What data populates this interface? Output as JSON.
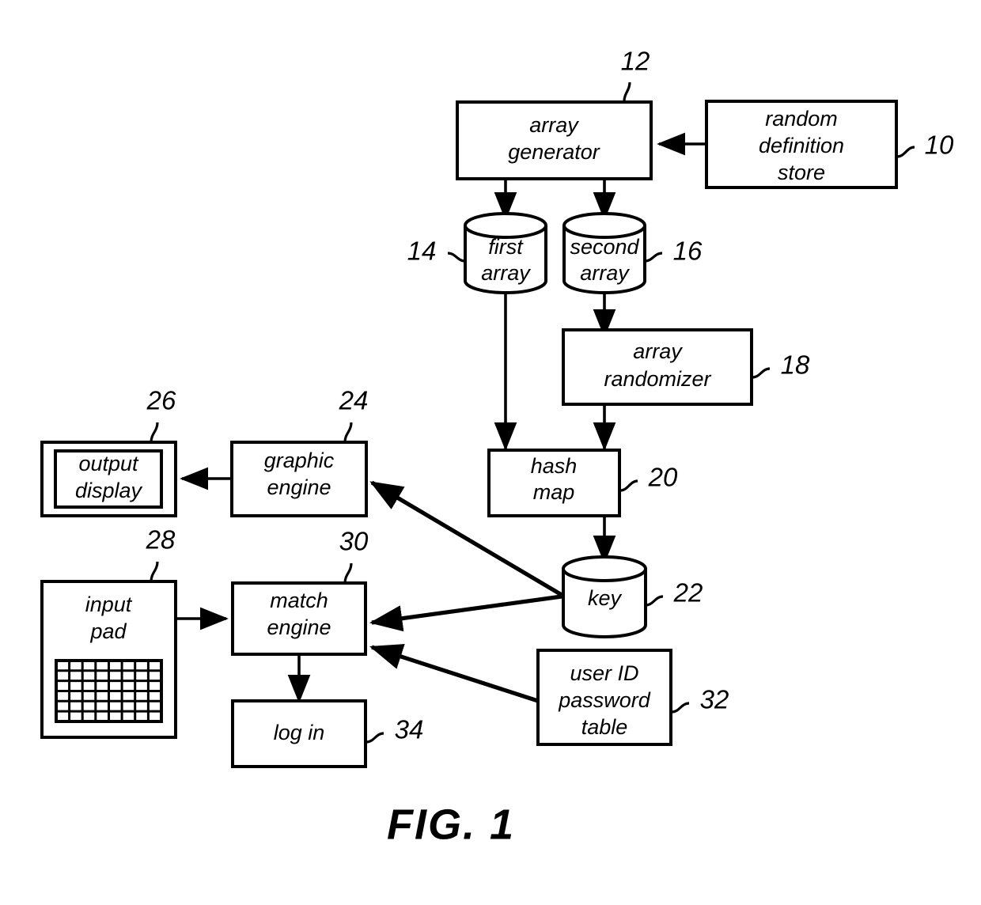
{
  "figure": {
    "caption": "FIG. 1",
    "title": "FIG. 1"
  },
  "nodes": {
    "random_definition_store": {
      "label_line1": "random",
      "label_line2": "definition",
      "label_line3": "store",
      "ref": "10",
      "shape": "rect"
    },
    "array_generator": {
      "label_line1": "array",
      "label_line2": "generator",
      "ref": "12",
      "shape": "rect"
    },
    "first_array": {
      "label_line1": "first",
      "label_line2": "array",
      "ref": "14",
      "shape": "cylinder"
    },
    "second_array": {
      "label_line1": "second",
      "label_line2": "array",
      "ref": "16",
      "shape": "cylinder"
    },
    "array_randomizer": {
      "label_line1": "array",
      "label_line2": "randomizer",
      "ref": "18",
      "shape": "rect"
    },
    "hash_map": {
      "label_line1": "hash",
      "label_line2": "map",
      "ref": "20",
      "shape": "rect"
    },
    "key": {
      "label_line1": "key",
      "ref": "22",
      "shape": "cylinder"
    },
    "graphic_engine": {
      "label_line1": "graphic",
      "label_line2": "engine",
      "ref": "24",
      "shape": "rect"
    },
    "output_display": {
      "label_line1": "output",
      "label_line2": "display",
      "ref": "26",
      "shape": "double-rect"
    },
    "input_pad": {
      "label_line1": "input",
      "label_line2": "pad",
      "ref": "28",
      "shape": "rect-with-grid",
      "grid_columns": 8,
      "grid_rows": 6
    },
    "match_engine": {
      "label_line1": "match",
      "label_line2": "engine",
      "ref": "30",
      "shape": "rect"
    },
    "user_id_password_table": {
      "label_line1": "user ID",
      "label_line2": "password",
      "label_line3": "table",
      "ref": "32",
      "shape": "rect"
    },
    "log_in": {
      "label_line1": "log in",
      "ref": "34",
      "shape": "rect"
    }
  },
  "colors": {
    "stroke": "#000000",
    "fill": "#ffffff"
  }
}
